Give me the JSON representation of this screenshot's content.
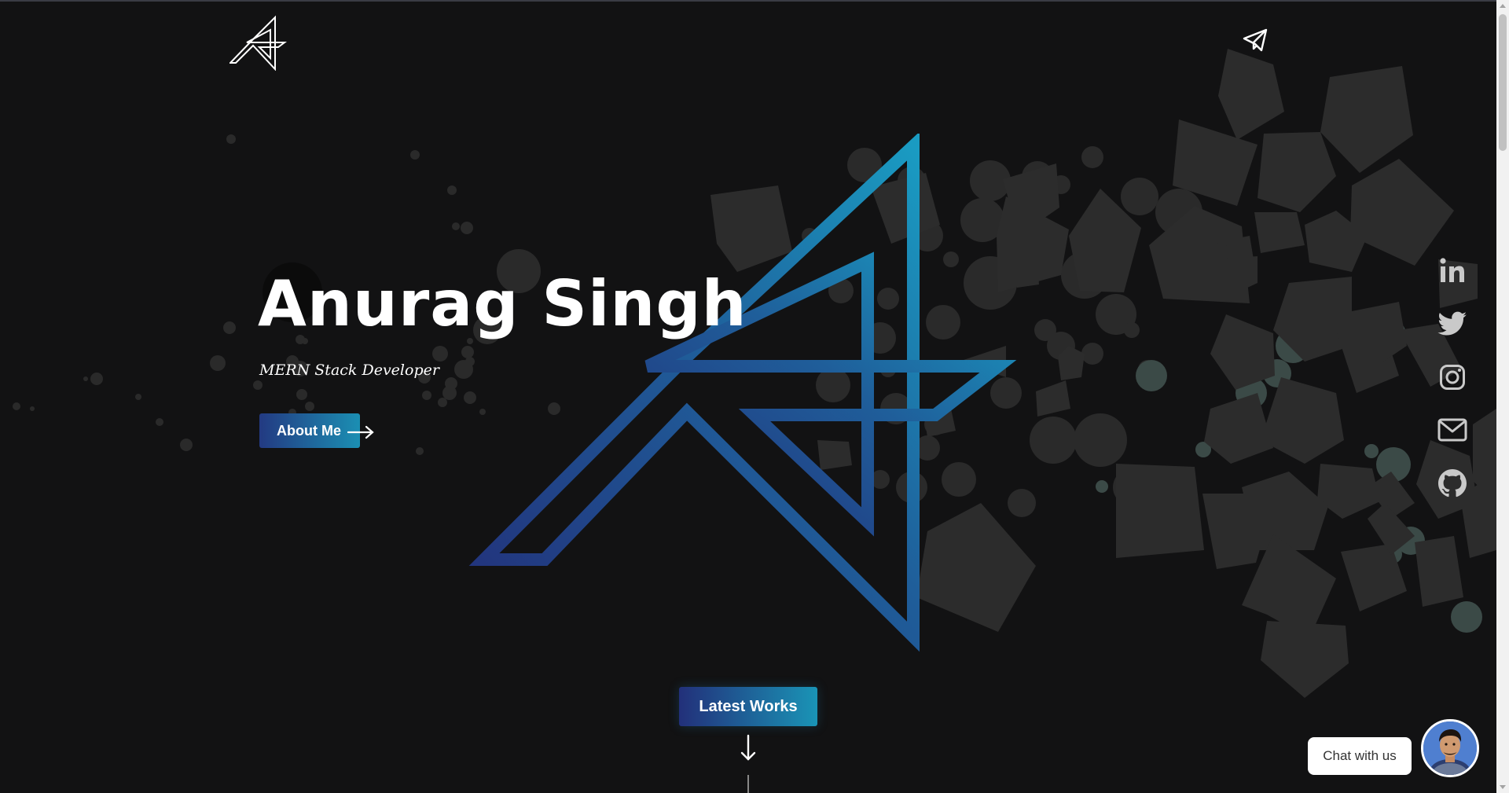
{
  "app": {
    "title": "Anurag Singh"
  },
  "hero": {
    "title": "Anurag Singh",
    "subtitle": "MERN Stack Developer",
    "about_button": "About Me"
  },
  "header": {
    "logo_icon": "monogram-logo-icon",
    "contact_icon": "paper-plane-icon"
  },
  "social": [
    {
      "name": "linkedin",
      "icon": "linkedin-icon"
    },
    {
      "name": "twitter",
      "icon": "twitter-icon"
    },
    {
      "name": "instagram",
      "icon": "instagram-icon"
    },
    {
      "name": "email",
      "icon": "mail-icon"
    },
    {
      "name": "github",
      "icon": "github-icon"
    }
  ],
  "works": {
    "button_label": "Latest Works"
  },
  "chat": {
    "label": "Chat with us"
  },
  "colors": {
    "background": "#121213",
    "accent_start": "#233a82",
    "accent_end": "#1b8fb3",
    "text": "#ffffff",
    "social_icon": "#c9c9c9"
  }
}
